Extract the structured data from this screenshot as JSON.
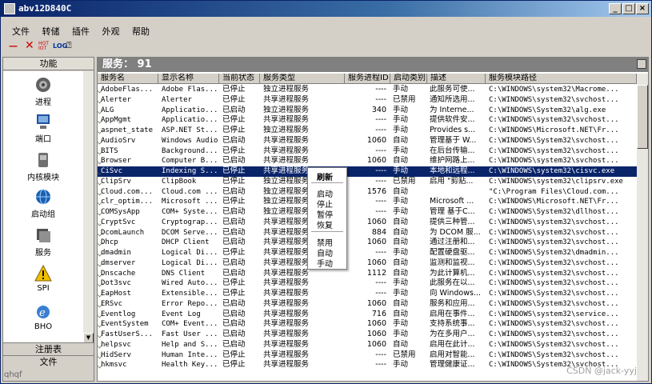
{
  "window": {
    "title": "abv12D840C"
  },
  "menu": [
    "文件",
    "转储",
    "插件",
    "外观",
    "帮助"
  ],
  "toolbar": {
    "hot": "HOT\nIOT",
    "log": "LOG"
  },
  "left_panel": {
    "header": "功能",
    "items": [
      {
        "label": "进程",
        "icon": "gear-icon"
      },
      {
        "label": "端口",
        "icon": "network-icon"
      },
      {
        "label": "内核模块",
        "icon": "disk-icon"
      },
      {
        "label": "启动组",
        "icon": "globe-icon"
      },
      {
        "label": "服务",
        "icon": "service-icon"
      },
      {
        "label": "SPI",
        "icon": "warning-icon"
      },
      {
        "label": "BHO",
        "icon": "ie-icon"
      }
    ],
    "bottom_tabs": [
      "注册表",
      "文件"
    ]
  },
  "main": {
    "banner": "服务：  91",
    "columns": [
      "服务名",
      "显示名称",
      "当前状态",
      "服务类型",
      "服务进程ID",
      "启动类别",
      "描述",
      "服务模块路径"
    ],
    "rows": [
      [
        "AdobeFlas...",
        "Adobe Flas...",
        "已停止",
        "独立进程服务",
        "----",
        "手动",
        "此服务可使...",
        "C:\\WINDOWS\\system32\\Macrome..."
      ],
      [
        "Alerter",
        "Alerter",
        "已停止",
        "共享进程服务",
        "----",
        "已禁用",
        "通知所选用...",
        "C:\\WINDOWS\\system32\\svchost..."
      ],
      [
        "ALG",
        "Applicatio...",
        "已启动",
        "独立进程服务",
        "340",
        "手动",
        "为 Interne...",
        "C:\\WINDOWS\\System32\\alg.exe"
      ],
      [
        "AppMgmt",
        "Applicatio...",
        "已停止",
        "共享进程服务",
        "----",
        "手动",
        "提供软件安...",
        "C:\\WINDOWS\\system32\\svchost..."
      ],
      [
        "aspnet_state",
        "ASP.NET St...",
        "已停止",
        "独立进程服务",
        "----",
        "手动",
        "Provides s...",
        "C:\\WINDOWS\\Microsoft.NET\\Fr..."
      ],
      [
        "AudioSrv",
        "Windows Audio",
        "已启动",
        "共享进程服务",
        "1060",
        "自动",
        "管理基于 W...",
        "C:\\WINDOWS\\System32\\svchost..."
      ],
      [
        "BITS",
        "Background...",
        "已停止",
        "共享进程服务",
        "----",
        "手动",
        "在后台传输...",
        "C:\\WINDOWS\\system32\\svchost..."
      ],
      [
        "Browser",
        "Computer B...",
        "已启动",
        "共享进程服务",
        "1060",
        "自动",
        "维护网路上...",
        "C:\\WINDOWS\\system32\\svchost..."
      ],
      [
        "CiSvc",
        "Indexing S...",
        "已停止",
        "共享进程服务",
        "----",
        "手动",
        "本地和远程...",
        "C:\\WINDOWS\\system32\\cisvc.exe"
      ],
      [
        "ClipSrv",
        "ClipBook",
        "已停止",
        "独立进程服务",
        "----",
        "已禁用",
        "启用 \"剪贴...",
        "C:\\WINDOWS\\system32\\clipsrv.exe"
      ],
      [
        "Cloud.com...",
        "Cloud.com ...",
        "已启动",
        "独立进程服务",
        "1576",
        "自动",
        "",
        "\"C:\\Program Files\\Cloud.com..."
      ],
      [
        "clr_optim...",
        "Microsoft ...",
        "已停止",
        "独立进程服务",
        "----",
        "手动",
        "Microsoft ...",
        "C:\\WINDOWS\\Microsoft.NET\\Fr..."
      ],
      [
        "COMSysApp",
        "COM+ Syste...",
        "已启动",
        "独立进程服务",
        "----",
        "手动",
        "管理 基于C...",
        "C:\\WINDOWS\\System32\\dllhost..."
      ],
      [
        "CryptSvc",
        "Cryptograp...",
        "已启动",
        "共享进程服务",
        "1060",
        "自动",
        "提供三种管...",
        "C:\\WINDOWS\\system32\\svchost..."
      ],
      [
        "DcomLaunch",
        "DCOM Serve...",
        "已启动",
        "共享进程服务",
        "884",
        "自动",
        "为 DCOM 服...",
        "C:\\WINDOWS\\system32\\svchost..."
      ],
      [
        "Dhcp",
        "DHCP Client",
        "已启动",
        "共享进程服务",
        "1060",
        "自动",
        "通过注册和...",
        "C:\\WINDOWS\\system32\\svchost..."
      ],
      [
        "dmadmin",
        "Logical Di...",
        "已停止",
        "共享进程服务",
        "----",
        "手动",
        "配置硬盘驱...",
        "C:\\WINDOWS\\System32\\dmadmin..."
      ],
      [
        "dmserver",
        "Logical Di...",
        "已启动",
        "共享进程服务",
        "1060",
        "自动",
        "监测和监视...",
        "C:\\WINDOWS\\System32\\svchost..."
      ],
      [
        "Dnscache",
        "DNS Client",
        "已启动",
        "共享进程服务",
        "1112",
        "自动",
        "为此计算机...",
        "C:\\WINDOWS\\system32\\svchost..."
      ],
      [
        "Dot3svc",
        "Wired Auto...",
        "已停止",
        "共享进程服务",
        "----",
        "手动",
        "此服务在以...",
        "C:\\WINDOWS\\system32\\svchost..."
      ],
      [
        "EapHost",
        "Extensible...",
        "已停止",
        "共享进程服务",
        "----",
        "手动",
        "向 Windows...",
        "C:\\WINDOWS\\System32\\svchost..."
      ],
      [
        "ERSvc",
        "Error Repo...",
        "已启动",
        "共享进程服务",
        "1060",
        "自动",
        "服务和应用...",
        "C:\\WINDOWS\\System32\\svchost..."
      ],
      [
        "Eventlog",
        "Event Log",
        "已启动",
        "共享进程服务",
        "716",
        "自动",
        "启用在事件...",
        "C:\\WINDOWS\\system32\\service..."
      ],
      [
        "EventSystem",
        "COM+ Event...",
        "已启动",
        "共享进程服务",
        "1060",
        "手动",
        "支持系统事...",
        "C:\\WINDOWS\\system32\\svchost..."
      ],
      [
        "FastUserS...",
        "Fast User ...",
        "已启动",
        "共享进程服务",
        "1060",
        "手动",
        "为在多用户...",
        "C:\\WINDOWS\\system32\\svchost..."
      ],
      [
        "helpsvc",
        "Help and S...",
        "已启动",
        "共享进程服务",
        "1060",
        "自动",
        "启用在此计...",
        "C:\\WINDOWS\\System32\\svchost..."
      ],
      [
        "HidServ",
        "Human Inte...",
        "已停止",
        "共享进程服务",
        "----",
        "已禁用",
        "启用对智能...",
        "C:\\WINDOWS\\System32\\svchost..."
      ],
      [
        "hkmsvc",
        "Health Key...",
        "已停止",
        "共享进程服务",
        "----",
        "手动",
        "管理健康证...",
        "C:\\WINDOWS\\System32\\svchost..."
      ]
    ],
    "selected_row": 8
  },
  "context_menu": {
    "items": [
      "刷新",
      "启动",
      "停止",
      "暂停",
      "恢复",
      "禁用",
      "自动",
      "手动"
    ]
  },
  "watermark": "CSDN @jack-yyj",
  "status_left": "qhqf"
}
